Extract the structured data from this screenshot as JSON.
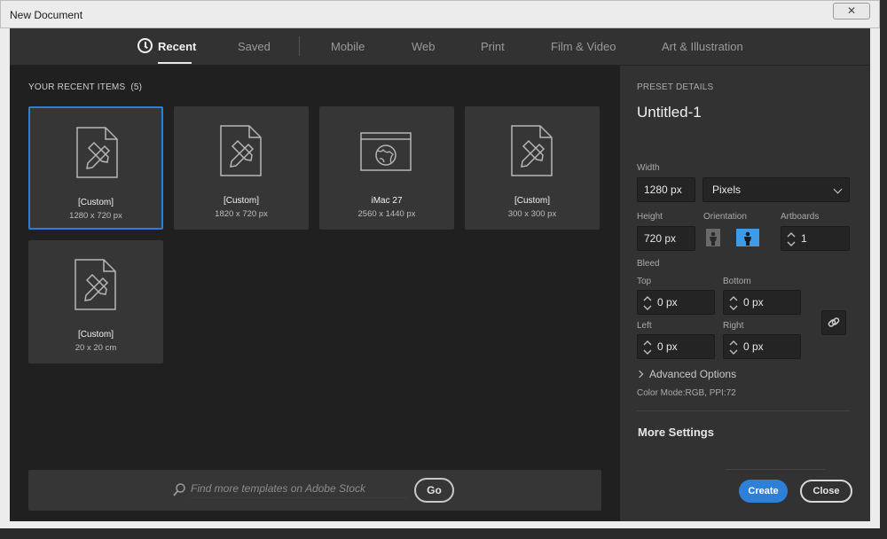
{
  "window": {
    "title": "New Document",
    "close_label": "✕"
  },
  "nav": {
    "tabs": [
      {
        "label": "Recent"
      },
      {
        "label": "Saved"
      },
      {
        "label": "Mobile"
      },
      {
        "label": "Web"
      },
      {
        "label": "Print"
      },
      {
        "label": "Film & Video"
      },
      {
        "label": "Art & Illustration"
      }
    ]
  },
  "recent": {
    "heading": "YOUR RECENT ITEMS",
    "count": "(5)",
    "items": [
      {
        "name": "[Custom]",
        "dims": "1280 x 720 px",
        "icon": "document-pencil-icon"
      },
      {
        "name": "[Custom]",
        "dims": "1820 x 720 px",
        "icon": "document-pencil-icon"
      },
      {
        "name": "iMac 27",
        "dims": "2560 x 1440 px",
        "icon": "web-browser-icon"
      },
      {
        "name": "[Custom]",
        "dims": "300 x 300 px",
        "icon": "document-pencil-icon"
      },
      {
        "name": "[Custom]",
        "dims": "20 x 20 cm",
        "icon": "document-pencil-icon"
      }
    ]
  },
  "search": {
    "placeholder": "Find more templates on Adobe Stock",
    "go_label": "Go"
  },
  "preset": {
    "heading": "PRESET DETAILS",
    "name": "Untitled-1",
    "width_label": "Width",
    "width_value": "1280 px",
    "unit_value": "Pixels",
    "height_label": "Height",
    "height_value": "720 px",
    "orientation_label": "Orientation",
    "artboards_label": "Artboards",
    "artboards_value": "1",
    "bleed_label": "Bleed",
    "top_label": "Top",
    "top_value": "0 px",
    "bottom_label": "Bottom",
    "bottom_value": "0 px",
    "left_label": "Left",
    "left_value": "0 px",
    "right_label": "Right",
    "right_value": "0 px",
    "advanced_label": "Advanced Options",
    "color_mode": "Color Mode:RGB, PPI:72",
    "more_settings": "More Settings",
    "create_label": "Create",
    "close_label": "Close"
  },
  "colors": {
    "accent": "#2d7fd8",
    "panel": "#323232",
    "background": "#1f1f1f"
  }
}
